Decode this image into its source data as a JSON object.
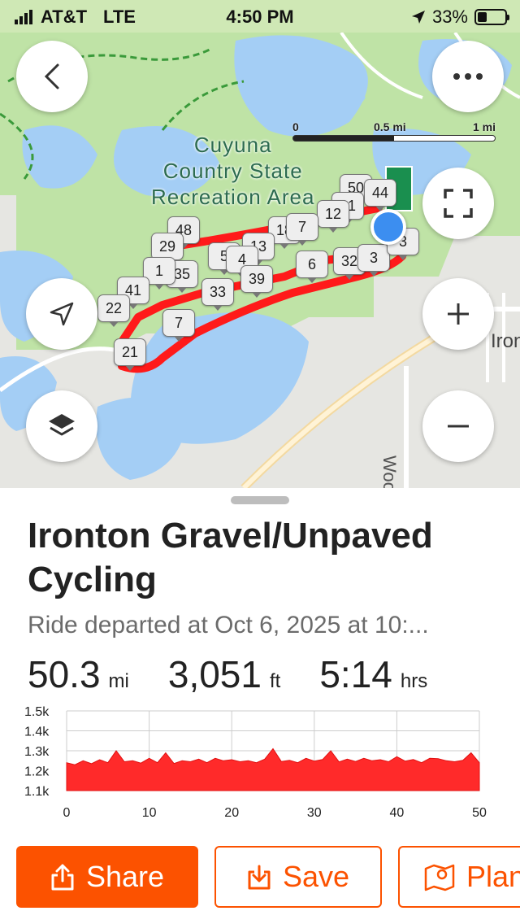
{
  "status_bar": {
    "carrier": "AT&T",
    "network": "LTE",
    "time": "4:50 PM",
    "battery": "33%",
    "battery_level": 0.33,
    "icons": [
      "signal-icon",
      "location-arrow-icon",
      "battery-icon"
    ]
  },
  "map": {
    "area_label": "Cuyuna\nCountry State\nRecreation Area",
    "town_label": "Iron",
    "road_label": "Wood",
    "scale": {
      "zero": "0",
      "half": "0.5 mi",
      "full": "1 mi"
    },
    "markers": [
      "50",
      "44",
      "21",
      "12",
      "18",
      "7",
      "48",
      "29",
      "5",
      "13",
      "4",
      "35",
      "1",
      "39",
      "6",
      "32",
      "3",
      "3",
      "41",
      "33",
      "22",
      "7",
      "21"
    ],
    "buttons": {
      "back": "back-icon",
      "more": "more-icon",
      "fullscreen": "fullscreen-icon",
      "locate": "navigation-icon",
      "zoom_in": "plus-icon",
      "zoom_out": "minus-icon",
      "layers": "layers-icon"
    },
    "colors": {
      "route": "#ff1a1a",
      "water": "#a4cef5",
      "park": "#bfe3a6",
      "location": "#3c8ef0"
    }
  },
  "activity": {
    "title": "Ironton Gravel/Unpaved Cycling",
    "subtitle": "Ride departed at Oct 6, 2025 at 10:...",
    "stats": [
      {
        "value": "50.3",
        "unit": "mi"
      },
      {
        "value": "3,051",
        "unit": "ft"
      },
      {
        "value": "5:14",
        "unit": "hrs"
      }
    ]
  },
  "chart_data": {
    "type": "area",
    "x_ticks": [
      "0",
      "10",
      "20",
      "30",
      "40",
      "50"
    ],
    "y_ticks": [
      "1.5k",
      "1.4k",
      "1.3k",
      "1.2k",
      "1.1k"
    ],
    "xlim": [
      0,
      50
    ],
    "ylim": [
      1100,
      1500
    ],
    "grid": true,
    "color": "#ff2a2a",
    "x": [
      0,
      1,
      2,
      3,
      4,
      5,
      6,
      7,
      8,
      9,
      10,
      11,
      12,
      13,
      14,
      15,
      16,
      17,
      18,
      19,
      20,
      21,
      22,
      23,
      24,
      25,
      26,
      27,
      28,
      29,
      30,
      31,
      32,
      33,
      34,
      35,
      36,
      37,
      38,
      39,
      40,
      41,
      42,
      43,
      44,
      45,
      46,
      47,
      48,
      49,
      50
    ],
    "y": [
      1240,
      1230,
      1250,
      1235,
      1255,
      1240,
      1300,
      1245,
      1250,
      1238,
      1262,
      1240,
      1290,
      1236,
      1250,
      1245,
      1258,
      1240,
      1262,
      1250,
      1255,
      1245,
      1250,
      1240,
      1258,
      1310,
      1246,
      1252,
      1240,
      1262,
      1248,
      1256,
      1300,
      1244,
      1258,
      1246,
      1262,
      1250,
      1255,
      1245,
      1270,
      1248,
      1256,
      1240,
      1262,
      1260,
      1250,
      1245,
      1252,
      1290,
      1240
    ]
  },
  "actions": [
    {
      "label": "Share",
      "icon": "share-icon",
      "style": "primary"
    },
    {
      "label": "Save",
      "icon": "download-icon",
      "style": "outline"
    },
    {
      "label": "Plan",
      "icon": "map-pin-icon",
      "style": "outline"
    }
  ]
}
